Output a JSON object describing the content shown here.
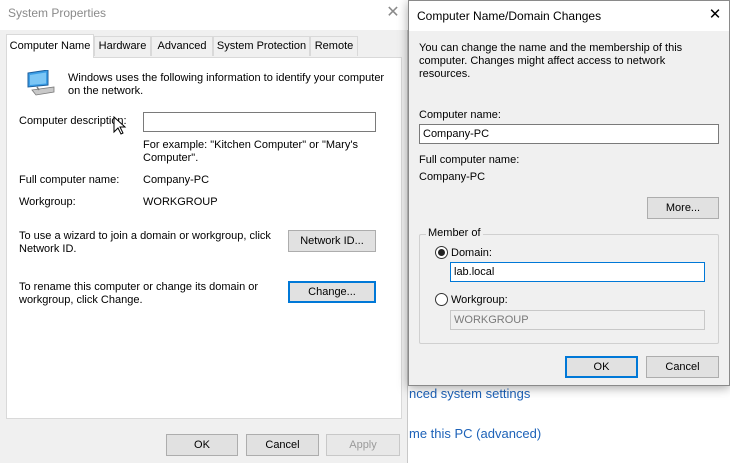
{
  "system_properties": {
    "title": "System Properties",
    "close_glyph": "✕",
    "tabs": [
      {
        "label": "Computer Name",
        "active": true
      },
      {
        "label": "Hardware"
      },
      {
        "label": "Advanced"
      },
      {
        "label": "System Protection"
      },
      {
        "label": "Remote"
      }
    ],
    "intro_text": "Windows uses the following information to identify your computer on the network.",
    "computer_description_label": "Computer description:",
    "computer_description_value": "",
    "example_text": "For example: \"Kitchen Computer\" or \"Mary's Computer\".",
    "full_name_label": "Full computer name:",
    "full_name_value": "Company-PC",
    "workgroup_label": "Workgroup:",
    "workgroup_value": "WORKGROUP",
    "wizard_text": "To use a wizard to join a domain or workgroup, click Network ID.",
    "network_id_button": "Network ID...",
    "rename_text": "To rename this computer or change its domain or workgroup, click Change.",
    "change_button": "Change...",
    "ok_button": "OK",
    "cancel_button": "Cancel",
    "apply_button": "Apply"
  },
  "background_links": [
    "nced system settings",
    "me this PC (advanced)"
  ],
  "dialog": {
    "title": "Computer Name/Domain Changes",
    "close_glyph": "✕",
    "intro_text": "You can change the name and the membership of this computer. Changes might affect access to network resources.",
    "computer_name_label": "Computer name:",
    "computer_name_value": "Company-PC",
    "full_name_label": "Full computer name:",
    "full_name_value": "Company-PC",
    "more_button": "More...",
    "member_of_label": "Member of",
    "domain_label": "Domain:",
    "domain_value": "lab.local",
    "domain_selected": true,
    "workgroup_label": "Workgroup:",
    "workgroup_value": "WORKGROUP",
    "ok_button": "OK",
    "cancel_button": "Cancel"
  },
  "colors": {
    "accent": "#0078d7",
    "link": "#1d62b8",
    "window_bg": "#f0f0f0"
  }
}
